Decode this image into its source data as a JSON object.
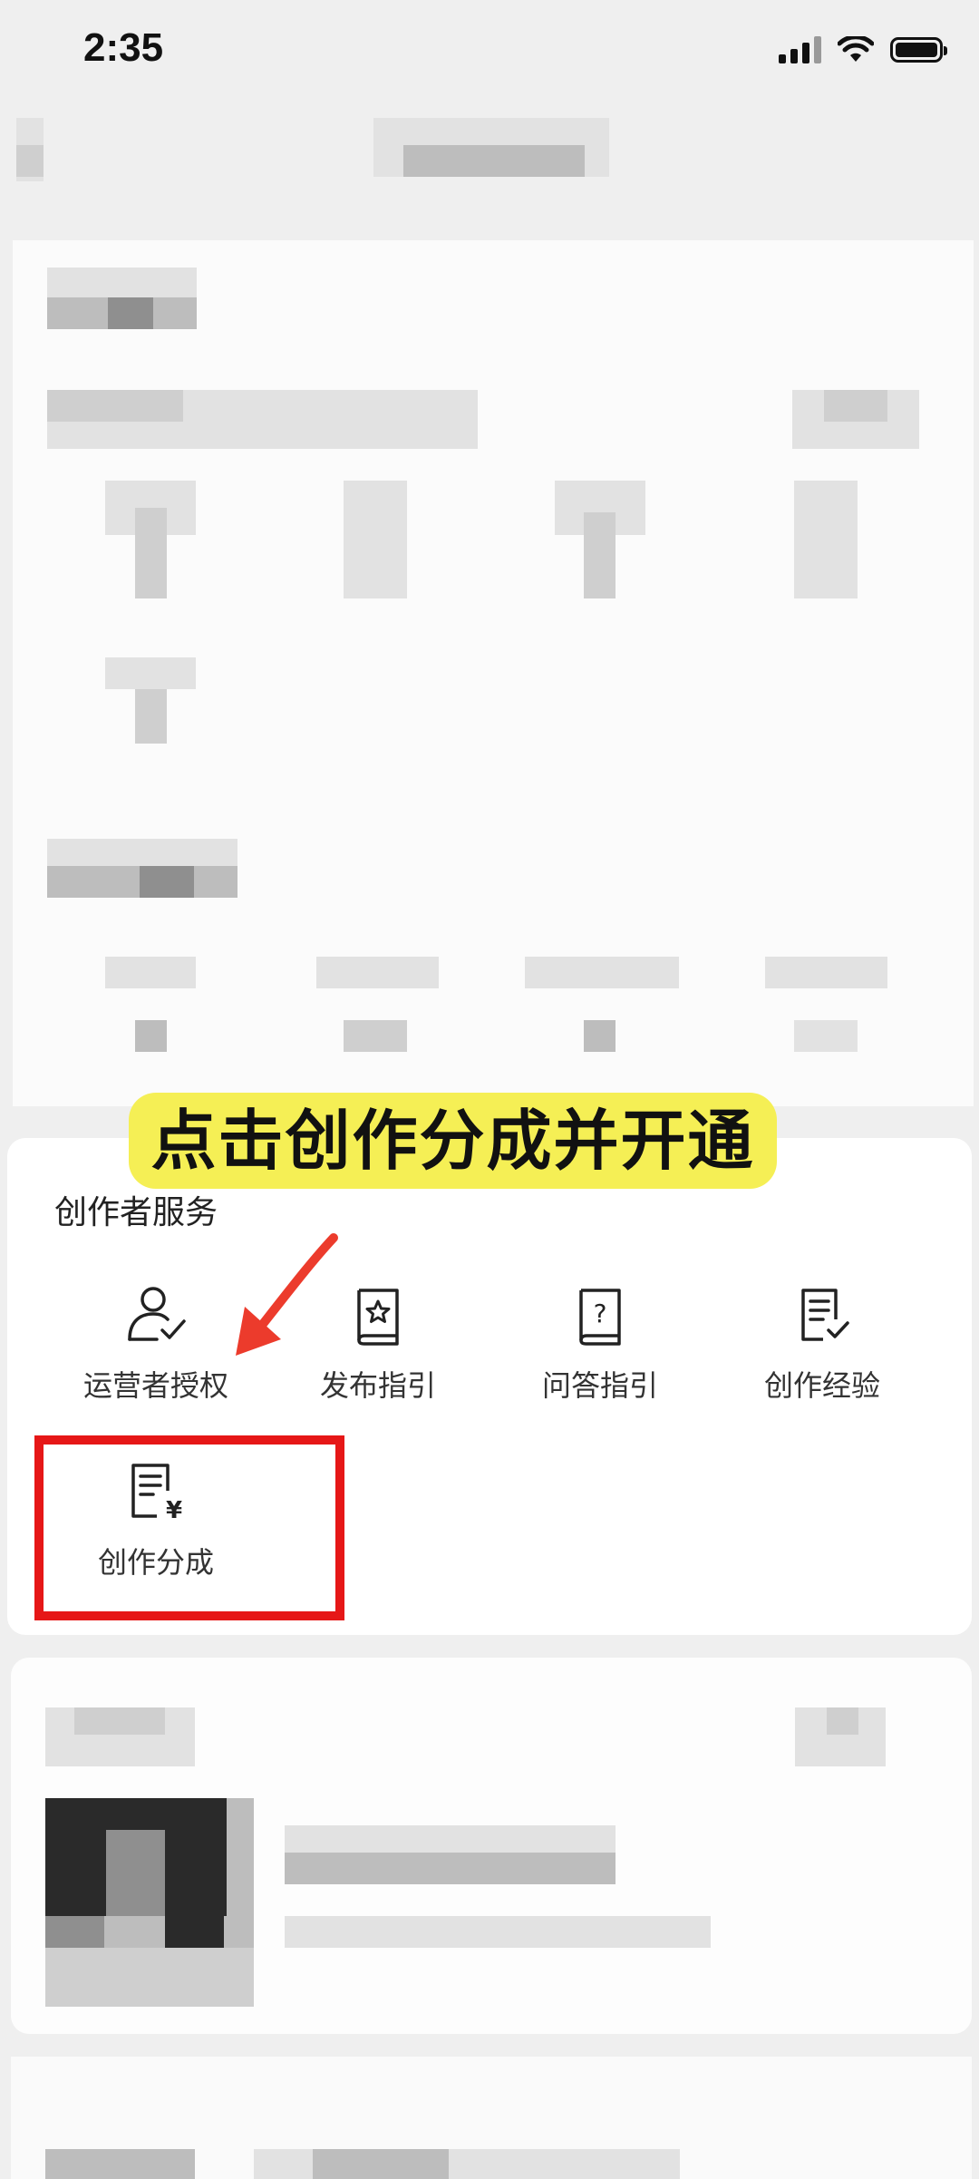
{
  "status_bar": {
    "time": "2:35"
  },
  "annotation": {
    "banner_text": "点击创作分成并开通",
    "banner_color": "#f5ef55",
    "highlight_color": "#e61717"
  },
  "creator_services": {
    "title": "创作者服务",
    "items": [
      {
        "label": "运营者授权",
        "icon": "user-check-icon"
      },
      {
        "label": "发布指引",
        "icon": "book-star-icon"
      },
      {
        "label": "问答指引",
        "icon": "book-question-icon"
      },
      {
        "label": "创作经验",
        "icon": "document-check-icon"
      },
      {
        "label": "创作分成",
        "icon": "document-yen-icon"
      }
    ]
  }
}
